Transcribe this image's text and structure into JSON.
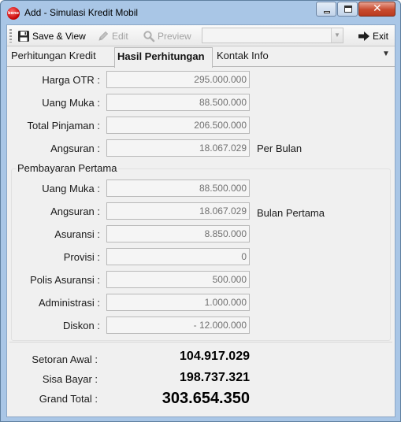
{
  "window": {
    "icon_text": "beno",
    "title": "Add - Simulasi Kredit Mobil",
    "close_glyph": "✕"
  },
  "toolbar": {
    "save_label": "Save & View",
    "edit_label": "Edit",
    "preview_label": "Preview",
    "combo_value": "",
    "exit_label": "Exit"
  },
  "tabs": [
    {
      "label": "Perhitungan Kredit",
      "active": false
    },
    {
      "label": "Hasil Perhitungan",
      "active": true
    },
    {
      "label": "Kontak Info",
      "active": false
    }
  ],
  "tab_menu_glyph": "▼",
  "summary_fields": [
    {
      "label": "Harga OTR :",
      "value": "295.000.000",
      "note": ""
    },
    {
      "label": "Uang Muka :",
      "value": "88.500.000",
      "note": ""
    },
    {
      "label": "Total Pinjaman :",
      "value": "206.500.000",
      "note": ""
    },
    {
      "label": "Angsuran :",
      "value": "18.067.029",
      "note": "Per Bulan"
    }
  ],
  "first_payment": {
    "title": "Pembayaran Pertama",
    "fields": [
      {
        "label": "Uang Muka :",
        "value": "88.500.000",
        "note": ""
      },
      {
        "label": "Angsuran :",
        "value": "18.067.029",
        "note": "Bulan Pertama"
      },
      {
        "label": "Asuransi :",
        "value": "8.850.000",
        "note": ""
      },
      {
        "label": "Provisi :",
        "value": "0",
        "note": ""
      },
      {
        "label": "Polis Asuransi :",
        "value": "500.000",
        "note": ""
      },
      {
        "label": "Administrasi :",
        "value": "1.000.000",
        "note": ""
      },
      {
        "label": "Diskon :",
        "value": "- 12.000.000",
        "note": ""
      }
    ]
  },
  "totals": [
    {
      "label": "Setoran Awal :",
      "value": "104.917.029",
      "size": "md"
    },
    {
      "label": "Sisa Bayar :",
      "value": "198.737.321",
      "size": "md"
    },
    {
      "label": "Grand Total :",
      "value": "303.654.350",
      "size": "lg"
    }
  ],
  "colors": {
    "title_bar": "#a9c6e6",
    "close_button": "#c84a2e",
    "client_bg": "#f0f0f0",
    "field_bg": "#f5f5f5",
    "field_text": "#707070"
  }
}
